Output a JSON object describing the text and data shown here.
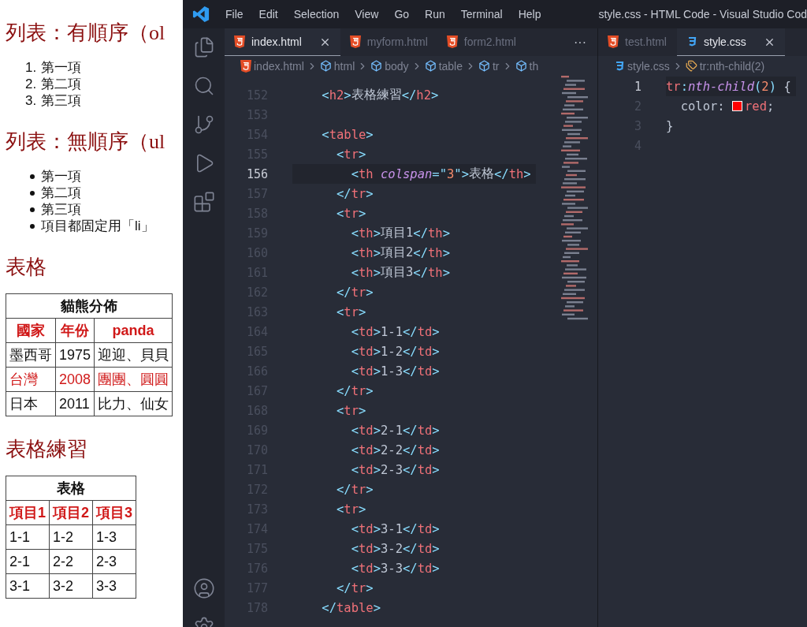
{
  "browser": {
    "sections": [
      {
        "kind": "heading",
        "text": "列表：有順序（ol"
      },
      {
        "kind": "ordered_list",
        "items": [
          {
            "marker": "1.",
            "text": "第一項"
          },
          {
            "marker": "2.",
            "text": "第二項"
          },
          {
            "marker": "3.",
            "text": "第三項"
          }
        ]
      },
      {
        "kind": "heading",
        "text": "列表：無順序（ul"
      },
      {
        "kind": "unordered_list",
        "items": [
          {
            "text": "第一項"
          },
          {
            "text": "第二項"
          },
          {
            "text": "第三項"
          },
          {
            "text": "項目都固定用「li」"
          }
        ]
      },
      {
        "kind": "heading",
        "text": "表格"
      },
      {
        "kind": "table",
        "rows": [
          {
            "kind": "caption",
            "highlighted": false,
            "cells": [
              {
                "text": "貓熊分佈",
                "colspan": 3
              }
            ]
          },
          {
            "kind": "header",
            "highlighted": true,
            "cells": [
              "國家",
              "年份",
              "panda"
            ]
          },
          {
            "kind": "data",
            "highlighted": false,
            "cells": [
              "墨西哥",
              "1975",
              "迎迎、貝貝"
            ]
          },
          {
            "kind": "data",
            "highlighted": true,
            "cells": [
              "台灣",
              "2008",
              "團團、圓圓"
            ]
          },
          {
            "kind": "data",
            "highlighted": false,
            "cells": [
              "日本",
              "2011",
              "比力、仙女"
            ]
          }
        ]
      },
      {
        "kind": "heading",
        "text": "表格練習"
      },
      {
        "kind": "table",
        "rows": [
          {
            "kind": "caption",
            "highlighted": false,
            "cells": [
              {
                "text": "表格",
                "colspan": 3
              }
            ]
          },
          {
            "kind": "header",
            "highlighted": true,
            "cells": [
              "項目1",
              "項目2",
              "項目3"
            ]
          },
          {
            "kind": "data",
            "highlighted": false,
            "cells": [
              "1-1",
              "1-2",
              "1-3"
            ]
          },
          {
            "kind": "data",
            "highlighted": false,
            "cells": [
              "2-1",
              "2-2",
              "2-3"
            ]
          },
          {
            "kind": "data",
            "highlighted": false,
            "cells": [
              "3-1",
              "3-2",
              "3-3"
            ]
          }
        ]
      }
    ]
  },
  "title_bar": {
    "menu": [
      "File",
      "Edit",
      "Selection",
      "View",
      "Go",
      "Run",
      "Terminal",
      "Help"
    ],
    "title": "style.css - HTML Code - Visual Studio Cod"
  },
  "editor_groups": [
    {
      "tabs": [
        {
          "label": "index.html",
          "kind": "html",
          "selected": true
        },
        {
          "label": "myform.html",
          "kind": "html",
          "selected": false
        },
        {
          "label": "form2.html",
          "kind": "html",
          "selected": false
        }
      ],
      "more": "···",
      "breadcrumb": [
        {
          "kind": "html-file",
          "label": "index.html"
        },
        {
          "kind": "element",
          "label": "html"
        },
        {
          "kind": "element",
          "label": "body"
        },
        {
          "kind": "element",
          "label": "table"
        },
        {
          "kind": "element",
          "label": "tr"
        },
        {
          "kind": "element",
          "label": "th"
        }
      ],
      "lines": [
        {
          "number": "152",
          "selected": false,
          "tokens": [
            {
              "kind": "punct",
              "text": "    <"
            },
            {
              "kind": "tag",
              "text": "h2"
            },
            {
              "kind": "punct",
              "text": ">"
            },
            {
              "kind": "text",
              "text": "表格練習"
            },
            {
              "kind": "punct",
              "text": "</"
            },
            {
              "kind": "tag",
              "text": "h2"
            },
            {
              "kind": "punct",
              "text": ">"
            }
          ]
        },
        {
          "number": "153",
          "selected": false
        },
        {
          "number": "154",
          "selected": false,
          "tokens": [
            {
              "kind": "punct",
              "text": "    <"
            },
            {
              "kind": "tag",
              "text": "table"
            },
            {
              "kind": "punct",
              "text": ">"
            }
          ]
        },
        {
          "number": "155",
          "selected": false,
          "tokens": [
            {
              "kind": "punct",
              "text": "      <"
            },
            {
              "kind": "tag",
              "text": "tr"
            },
            {
              "kind": "punct",
              "text": ">"
            }
          ]
        },
        {
          "number": "156",
          "selected": true,
          "tokens": [
            {
              "kind": "punct",
              "text": "        <"
            },
            {
              "kind": "tag",
              "text": "th"
            },
            {
              "kind": "attr",
              "text": " colspan"
            },
            {
              "kind": "punct",
              "text": "=\""
            },
            {
              "kind": "number",
              "text": "3"
            },
            {
              "kind": "punct",
              "text": "\">"
            },
            {
              "kind": "text",
              "text": "表格"
            },
            {
              "kind": "punct",
              "text": "</"
            },
            {
              "kind": "tag",
              "text": "th"
            },
            {
              "kind": "punct",
              "text": ">"
            }
          ]
        },
        {
          "number": "157",
          "selected": false,
          "tokens": [
            {
              "kind": "punct",
              "text": "      </"
            },
            {
              "kind": "tag",
              "text": "tr"
            },
            {
              "kind": "punct",
              "text": ">"
            }
          ]
        },
        {
          "number": "158",
          "selected": false,
          "tokens": [
            {
              "kind": "punct",
              "text": "      <"
            },
            {
              "kind": "tag",
              "text": "tr"
            },
            {
              "kind": "punct",
              "text": ">"
            }
          ]
        },
        {
          "number": "159",
          "selected": false,
          "tokens": [
            {
              "kind": "punct",
              "text": "        <"
            },
            {
              "kind": "tag",
              "text": "th"
            },
            {
              "kind": "punct",
              "text": ">"
            },
            {
              "kind": "text",
              "text": "項目1"
            },
            {
              "kind": "punct",
              "text": "</"
            },
            {
              "kind": "tag",
              "text": "th"
            },
            {
              "kind": "punct",
              "text": ">"
            }
          ]
        },
        {
          "number": "160",
          "selected": false,
          "tokens": [
            {
              "kind": "punct",
              "text": "        <"
            },
            {
              "kind": "tag",
              "text": "th"
            },
            {
              "kind": "punct",
              "text": ">"
            },
            {
              "kind": "text",
              "text": "項目2"
            },
            {
              "kind": "punct",
              "text": "</"
            },
            {
              "kind": "tag",
              "text": "th"
            },
            {
              "kind": "punct",
              "text": ">"
            }
          ]
        },
        {
          "number": "161",
          "selected": false,
          "tokens": [
            {
              "kind": "punct",
              "text": "        <"
            },
            {
              "kind": "tag",
              "text": "th"
            },
            {
              "kind": "punct",
              "text": ">"
            },
            {
              "kind": "text",
              "text": "項目3"
            },
            {
              "kind": "punct",
              "text": "</"
            },
            {
              "kind": "tag",
              "text": "th"
            },
            {
              "kind": "punct",
              "text": ">"
            }
          ]
        },
        {
          "number": "162",
          "selected": false,
          "tokens": [
            {
              "kind": "punct",
              "text": "      </"
            },
            {
              "kind": "tag",
              "text": "tr"
            },
            {
              "kind": "punct",
              "text": ">"
            }
          ]
        },
        {
          "number": "163",
          "selected": false,
          "tokens": [
            {
              "kind": "punct",
              "text": "      <"
            },
            {
              "kind": "tag",
              "text": "tr"
            },
            {
              "kind": "punct",
              "text": ">"
            }
          ]
        },
        {
          "number": "164",
          "selected": false,
          "tokens": [
            {
              "kind": "punct",
              "text": "        <"
            },
            {
              "kind": "tag",
              "text": "td"
            },
            {
              "kind": "punct",
              "text": ">"
            },
            {
              "kind": "text",
              "text": "1-1"
            },
            {
              "kind": "punct",
              "text": "</"
            },
            {
              "kind": "tag",
              "text": "td"
            },
            {
              "kind": "punct",
              "text": ">"
            }
          ]
        },
        {
          "number": "165",
          "selected": false,
          "tokens": [
            {
              "kind": "punct",
              "text": "        <"
            },
            {
              "kind": "tag",
              "text": "td"
            },
            {
              "kind": "punct",
              "text": ">"
            },
            {
              "kind": "text",
              "text": "1-2"
            },
            {
              "kind": "punct",
              "text": "</"
            },
            {
              "kind": "tag",
              "text": "td"
            },
            {
              "kind": "punct",
              "text": ">"
            }
          ]
        },
        {
          "number": "166",
          "selected": false,
          "tokens": [
            {
              "kind": "punct",
              "text": "        <"
            },
            {
              "kind": "tag",
              "text": "td"
            },
            {
              "kind": "punct",
              "text": ">"
            },
            {
              "kind": "text",
              "text": "1-3"
            },
            {
              "kind": "punct",
              "text": "</"
            },
            {
              "kind": "tag",
              "text": "td"
            },
            {
              "kind": "punct",
              "text": ">"
            }
          ]
        },
        {
          "number": "167",
          "selected": false,
          "tokens": [
            {
              "kind": "punct",
              "text": "      </"
            },
            {
              "kind": "tag",
              "text": "tr"
            },
            {
              "kind": "punct",
              "text": ">"
            }
          ]
        },
        {
          "number": "168",
          "selected": false,
          "tokens": [
            {
              "kind": "punct",
              "text": "      <"
            },
            {
              "kind": "tag",
              "text": "tr"
            },
            {
              "kind": "punct",
              "text": ">"
            }
          ]
        },
        {
          "number": "169",
          "selected": false,
          "tokens": [
            {
              "kind": "punct",
              "text": "        <"
            },
            {
              "kind": "tag",
              "text": "td"
            },
            {
              "kind": "punct",
              "text": ">"
            },
            {
              "kind": "text",
              "text": "2-1"
            },
            {
              "kind": "punct",
              "text": "</"
            },
            {
              "kind": "tag",
              "text": "td"
            },
            {
              "kind": "punct",
              "text": ">"
            }
          ]
        },
        {
          "number": "170",
          "selected": false,
          "tokens": [
            {
              "kind": "punct",
              "text": "        <"
            },
            {
              "kind": "tag",
              "text": "td"
            },
            {
              "kind": "punct",
              "text": ">"
            },
            {
              "kind": "text",
              "text": "2-2"
            },
            {
              "kind": "punct",
              "text": "</"
            },
            {
              "kind": "tag",
              "text": "td"
            },
            {
              "kind": "punct",
              "text": ">"
            }
          ]
        },
        {
          "number": "171",
          "selected": false,
          "tokens": [
            {
              "kind": "punct",
              "text": "        <"
            },
            {
              "kind": "tag",
              "text": "td"
            },
            {
              "kind": "punct",
              "text": ">"
            },
            {
              "kind": "text",
              "text": "2-3"
            },
            {
              "kind": "punct",
              "text": "</"
            },
            {
              "kind": "tag",
              "text": "td"
            },
            {
              "kind": "punct",
              "text": ">"
            }
          ]
        },
        {
          "number": "172",
          "selected": false,
          "tokens": [
            {
              "kind": "punct",
              "text": "      </"
            },
            {
              "kind": "tag",
              "text": "tr"
            },
            {
              "kind": "punct",
              "text": ">"
            }
          ]
        },
        {
          "number": "173",
          "selected": false,
          "tokens": [
            {
              "kind": "punct",
              "text": "      <"
            },
            {
              "kind": "tag",
              "text": "tr"
            },
            {
              "kind": "punct",
              "text": ">"
            }
          ]
        },
        {
          "number": "174",
          "selected": false,
          "tokens": [
            {
              "kind": "punct",
              "text": "        <"
            },
            {
              "kind": "tag",
              "text": "td"
            },
            {
              "kind": "punct",
              "text": ">"
            },
            {
              "kind": "text",
              "text": "3-1"
            },
            {
              "kind": "punct",
              "text": "</"
            },
            {
              "kind": "tag",
              "text": "td"
            },
            {
              "kind": "punct",
              "text": ">"
            }
          ]
        },
        {
          "number": "175",
          "selected": false,
          "tokens": [
            {
              "kind": "punct",
              "text": "        <"
            },
            {
              "kind": "tag",
              "text": "td"
            },
            {
              "kind": "punct",
              "text": ">"
            },
            {
              "kind": "text",
              "text": "3-2"
            },
            {
              "kind": "punct",
              "text": "</"
            },
            {
              "kind": "tag",
              "text": "td"
            },
            {
              "kind": "punct",
              "text": ">"
            }
          ]
        },
        {
          "number": "176",
          "selected": false,
          "tokens": [
            {
              "kind": "punct",
              "text": "        <"
            },
            {
              "kind": "tag",
              "text": "td"
            },
            {
              "kind": "punct",
              "text": ">"
            },
            {
              "kind": "text",
              "text": "3-3"
            },
            {
              "kind": "punct",
              "text": "</"
            },
            {
              "kind": "tag",
              "text": "td"
            },
            {
              "kind": "punct",
              "text": ">"
            }
          ]
        },
        {
          "number": "177",
          "selected": false,
          "tokens": [
            {
              "kind": "punct",
              "text": "      </"
            },
            {
              "kind": "tag",
              "text": "tr"
            },
            {
              "kind": "punct",
              "text": ">"
            }
          ]
        },
        {
          "number": "178",
          "selected": false,
          "tokens": [
            {
              "kind": "punct",
              "text": "    </"
            },
            {
              "kind": "tag",
              "text": "table"
            },
            {
              "kind": "punct",
              "text": ">"
            }
          ]
        }
      ]
    },
    {
      "tabs": [
        {
          "label": "test.html",
          "kind": "html",
          "selected": false
        },
        {
          "label": "style.css",
          "kind": "css",
          "selected": true
        }
      ],
      "breadcrumb": [
        {
          "kind": "css-file",
          "label": "style.css"
        },
        {
          "kind": "selector",
          "label": "tr:nth-child(2)"
        }
      ],
      "lines": [
        {
          "number": "1",
          "selected": true,
          "tokens": [
            {
              "kind": "tag",
              "text": "tr"
            },
            {
              "kind": "punct",
              "text": ":"
            },
            {
              "kind": "attr",
              "text": "nth-child"
            },
            {
              "kind": "punct",
              "text": "("
            },
            {
              "kind": "number",
              "text": "2"
            },
            {
              "kind": "punct",
              "text": ")"
            },
            {
              "kind": "text",
              "text": " {"
            }
          ]
        },
        {
          "number": "2",
          "selected": false,
          "tokens": [
            {
              "kind": "text",
              "text": "  color: "
            },
            {
              "kind": "swatch",
              "color": "#ff0000"
            },
            {
              "kind": "tag",
              "text": "red"
            },
            {
              "kind": "text",
              "text": ";"
            }
          ]
        },
        {
          "number": "3",
          "selected": false,
          "tokens": [
            {
              "kind": "text",
              "text": "}"
            }
          ]
        },
        {
          "number": "4",
          "selected": false
        }
      ]
    }
  ]
}
